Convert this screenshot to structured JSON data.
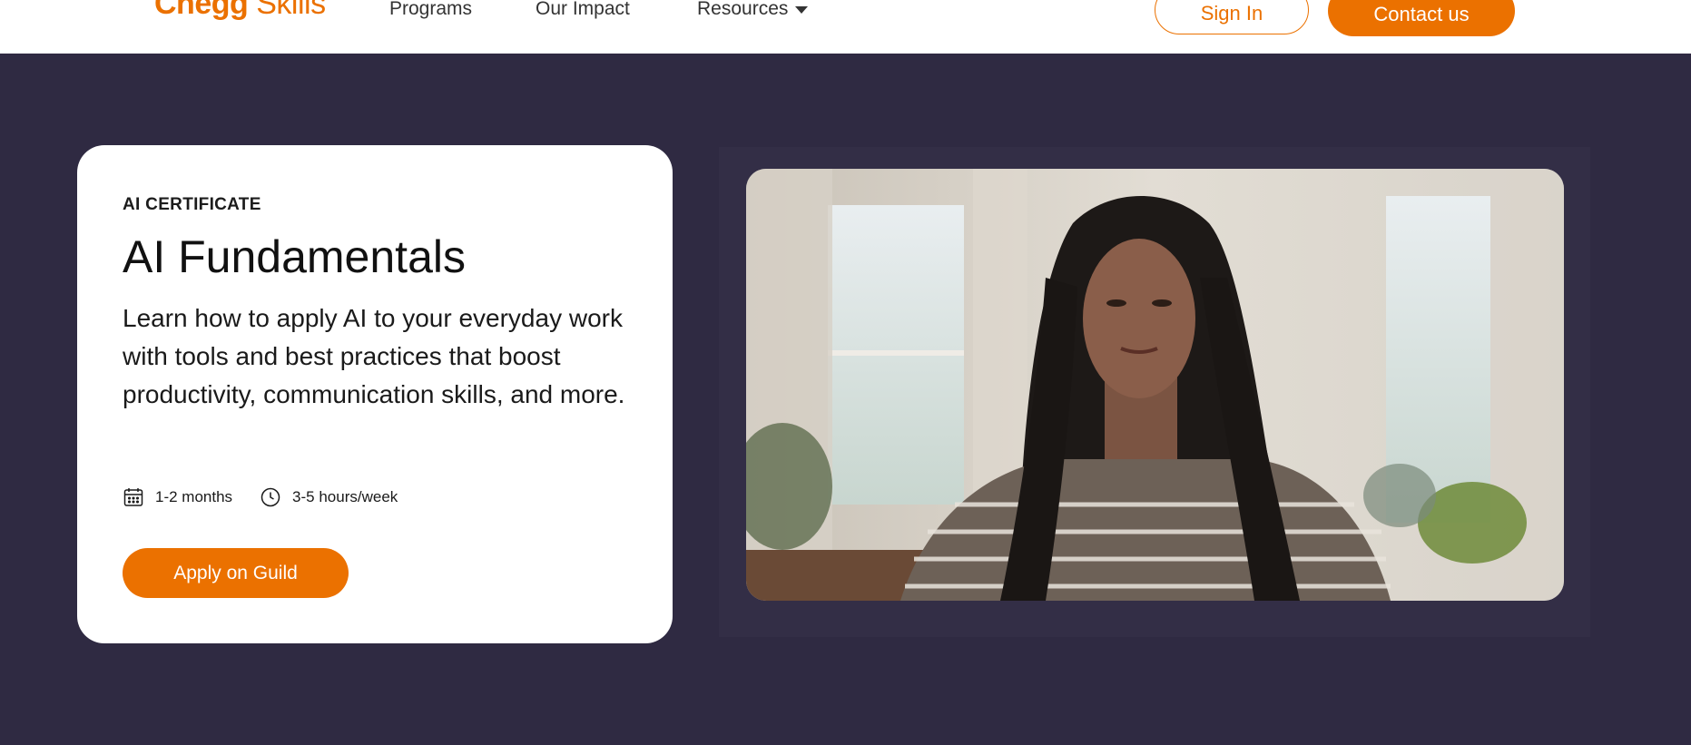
{
  "header": {
    "logo_bold": "Chegg",
    "logo_rest": " Skills",
    "nav": {
      "programs": "Programs",
      "impact": "Our Impact",
      "resources": "Resources"
    },
    "sign_in": "Sign In",
    "contact": "Contact us"
  },
  "card": {
    "eyebrow": "AI CERTIFICATE",
    "title": "AI Fundamentals",
    "description": "Learn how to apply AI to your everyday work with tools and best practices that boost productivity, communication skills, and more.",
    "duration": "1-2 months",
    "effort": "3-5 hours/week",
    "apply_label": "Apply on Guild"
  },
  "icons": {
    "calendar": "calendar-icon",
    "clock": "clock-icon",
    "caret": "chevron-down-icon"
  },
  "colors": {
    "brand_orange": "#eb7100",
    "hero_background": "#2f2a42",
    "card_background": "#ffffff"
  }
}
